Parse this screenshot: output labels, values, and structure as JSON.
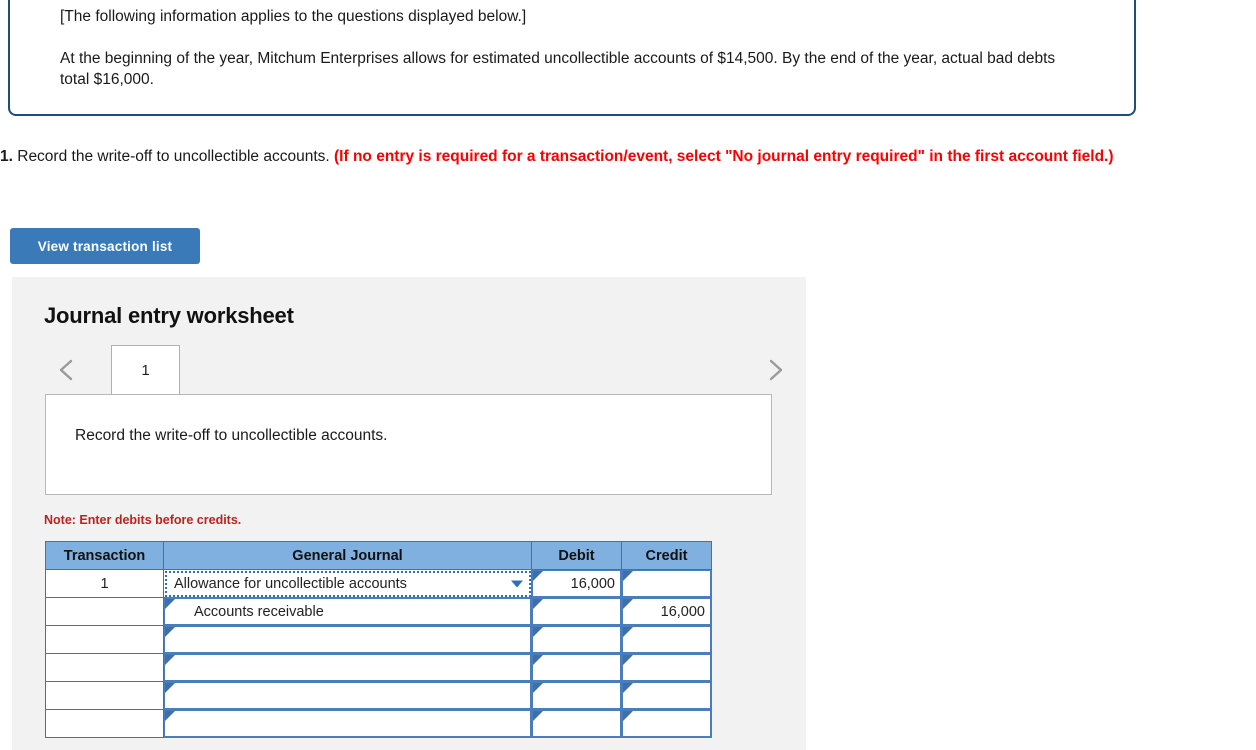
{
  "info_box": {
    "line1": "[The following information applies to the questions displayed below.]",
    "line2": "At the beginning of the year, Mitchum Enterprises allows for estimated uncollectible accounts of $14,500. By the end of the year, actual bad debts total $16,000."
  },
  "question": {
    "number": "1.",
    "text": " Record the write-off to uncollectible accounts. ",
    "hint": "(If no entry is required for a transaction/event, select \"No journal entry required\" in the first account field.)"
  },
  "toolbar": {
    "view_transaction_list_label": "View transaction list"
  },
  "worksheet": {
    "title": "Journal entry worksheet",
    "prev_label": "‹",
    "next_label": "›",
    "tabs": [
      {
        "label": "1",
        "active": true
      }
    ],
    "description": "Record the write-off to uncollectible accounts.",
    "note": "Note: Enter debits before credits.",
    "table": {
      "headers": [
        "Transaction",
        "General Journal",
        "Debit",
        "Credit"
      ],
      "rows": [
        {
          "transaction": "1",
          "account": "Allowance for uncollectible accounts",
          "indent": false,
          "is_select": true,
          "debit": "16,000",
          "credit": ""
        },
        {
          "transaction": "",
          "account": "Accounts receivable",
          "indent": true,
          "is_select": false,
          "debit": "",
          "credit": "16,000"
        },
        {
          "transaction": "",
          "account": "",
          "indent": false,
          "is_select": false,
          "debit": "",
          "credit": ""
        },
        {
          "transaction": "",
          "account": "",
          "indent": false,
          "is_select": false,
          "debit": "",
          "credit": ""
        },
        {
          "transaction": "",
          "account": "",
          "indent": false,
          "is_select": false,
          "debit": "",
          "credit": ""
        },
        {
          "transaction": "",
          "account": "",
          "indent": false,
          "is_select": false,
          "debit": "",
          "credit": ""
        }
      ]
    }
  },
  "colors": {
    "info_border": "#1f4e79",
    "button_blue": "#3a7ab8",
    "hint_red": "#fa0000",
    "note_red": "#bb2222",
    "table_header_blue": "#7fb0df",
    "cell_border_blue": "#4a7ebb",
    "panel_gray": "#f2f2f2"
  }
}
